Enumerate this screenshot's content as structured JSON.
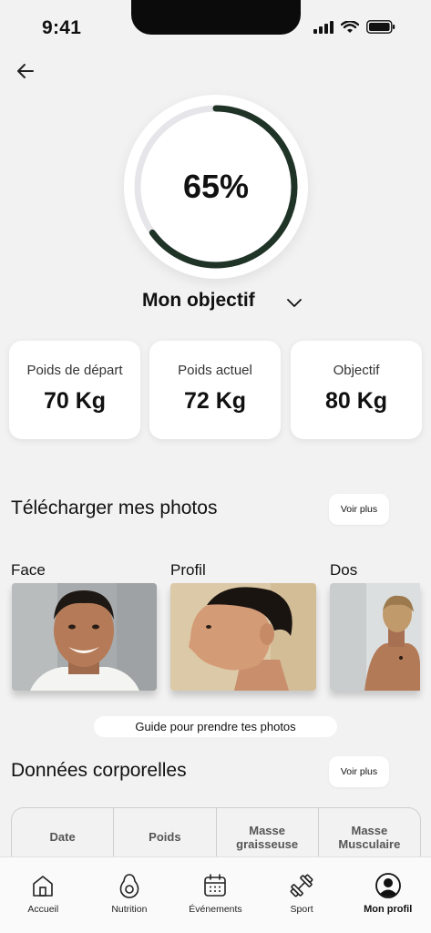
{
  "status_bar": {
    "time": "9:41"
  },
  "goal": {
    "percent_label": "65%",
    "progress": 0.65,
    "title": "Mon objectif",
    "ring_color": "#1f3326"
  },
  "stats": [
    {
      "label": "Poids de départ",
      "value": "70 Kg"
    },
    {
      "label": "Poids actuel",
      "value": "72 Kg"
    },
    {
      "label": "Objectif",
      "value": "80 Kg"
    }
  ],
  "photos_section": {
    "title": "Télécharger mes photos",
    "more_label": "Voir plus",
    "labels": [
      "Face",
      "Profil",
      "Dos"
    ],
    "guide_label": "Guide pour prendre tes photos"
  },
  "body_section": {
    "title": "Données corporelles",
    "more_label": "Voir plus",
    "columns": [
      "Date",
      "Poids",
      "Masse graisseuse",
      "Masse Musculaire"
    ]
  },
  "nav": [
    {
      "label": "Accueil",
      "icon": "home-icon"
    },
    {
      "label": "Nutrition",
      "icon": "avocado-icon"
    },
    {
      "label": "Événements",
      "icon": "calendar-icon"
    },
    {
      "label": "Sport",
      "icon": "dumbbell-icon"
    },
    {
      "label": "Mon profil",
      "icon": "profile-icon",
      "active": true
    }
  ]
}
